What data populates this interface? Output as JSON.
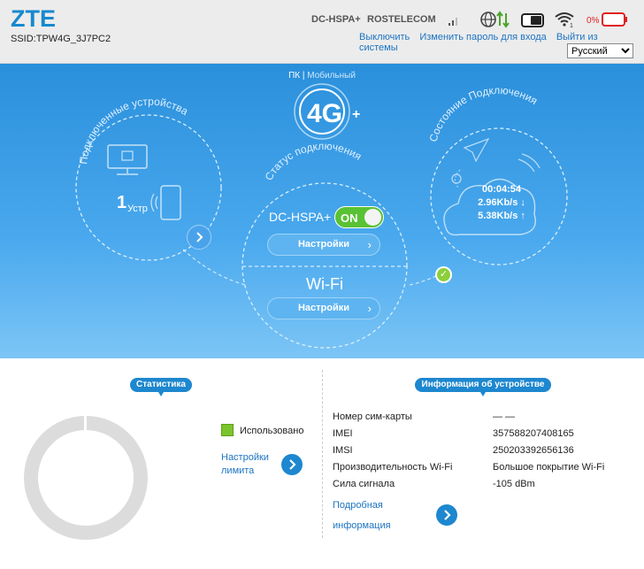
{
  "header": {
    "logo": "ZTE",
    "ssid": "SSID:TPW4G_3J7PC2",
    "network_type": "DC-HSPA+",
    "carrier": "ROSTELECOM",
    "battery_text": "0%",
    "links": [
      "Выключить",
      "Изменить пароль для входа",
      "Выйти из системы"
    ],
    "language": "Русский"
  },
  "mode": {
    "active": "ПК",
    "separator": " | ",
    "inactive": "Мобильный"
  },
  "devices": {
    "title": "Подключенные устройства",
    "count": "1",
    "unit": "Устр"
  },
  "connection_status": {
    "title": "Статус подключения",
    "network": "DC-HSPA+",
    "toggle_label": "ON",
    "settings_label": "Настройки",
    "wifi_label": "Wi-Fi",
    "wifi_settings_label": "Настройки"
  },
  "connection_state": {
    "title": "Состояние Подключения",
    "time": "00:04:54",
    "download": "2.96Kb/s ↓",
    "upload": "5.38Kb/s ↑"
  },
  "stats": {
    "title": "Статистика",
    "legend": "Использовано",
    "limit_link_line1": "Настройки",
    "limit_link_line2": "лимита"
  },
  "device_info": {
    "title": "Информация об устройстве",
    "rows": [
      {
        "label": "Номер сим-карты",
        "value": "— —"
      },
      {
        "label": "IMEI",
        "value": "357588207408165"
      },
      {
        "label": "IMSI",
        "value": "250203392656136"
      },
      {
        "label": "Производительность Wi-Fi",
        "value": "Большое покрытие Wi-Fi"
      },
      {
        "label": "Сила сигнала",
        "value": "-105 dBm"
      }
    ],
    "more_line1": "Подробная",
    "more_line2": "информация"
  },
  "colors": {
    "brand": "#1689cf",
    "toggle_on": "#59c234",
    "used": "#7cc42c",
    "battery_low": "#e02020"
  }
}
